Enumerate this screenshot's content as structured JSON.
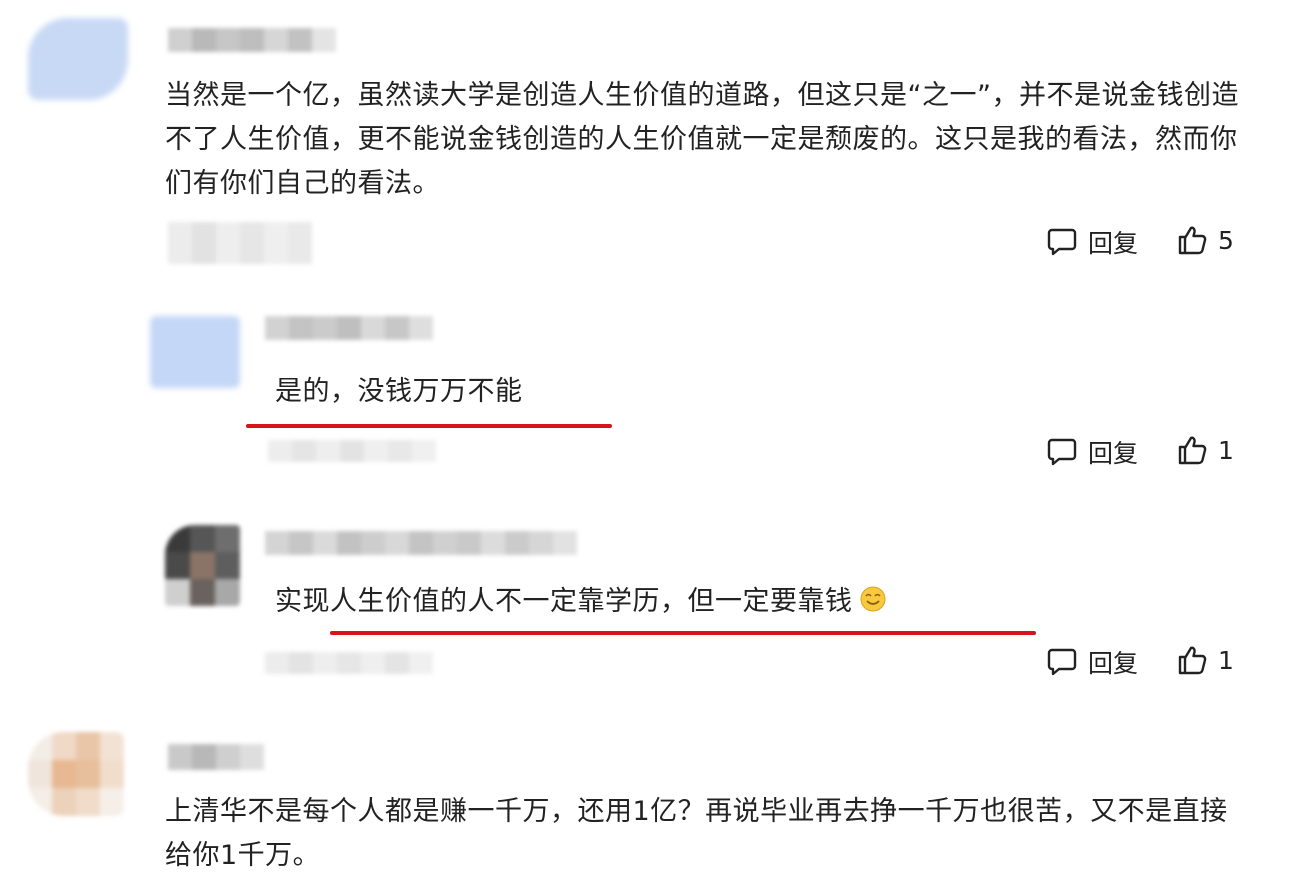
{
  "comments": [
    {
      "text": "当然是一个亿，虽然读大学是创造人生价值的道路，但这只是“之一”，并不是说金钱创造不了人生价值，更不能说金钱创造的人生价值就一定是颓废的。这只是我的看法，然而你们有你们自己的看法。",
      "reply_label": "回复",
      "likes": "5"
    },
    {
      "text": "是的，没钱万万不能",
      "reply_label": "回复",
      "likes": "1"
    },
    {
      "text": "实现人生价值的人不一定靠学历，但一定要靠钱",
      "emoji": "smiling-face-emoji",
      "reply_label": "回复",
      "likes": "1"
    },
    {
      "text": "上清华不是每个人都是赚一千万，还用1亿？再说毕业再去挣一千万也很苦，又不是直接给你1千万。"
    }
  ],
  "icons": {
    "reply": "comment-bubble-icon",
    "like": "thumbs-up-icon"
  },
  "colors": {
    "highlight_underline": "#d8141b",
    "text": "#222222"
  }
}
